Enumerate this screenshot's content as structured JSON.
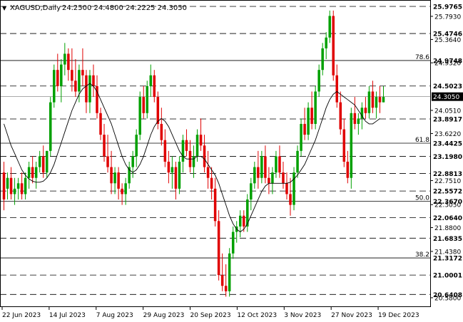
{
  "header": {
    "symbol": "XAGUSD,Daily",
    "ohlc": "24.2500 24.4800 24.2225 24.3050",
    "dropdown_glyph": "▼"
  },
  "colors": {
    "bull": "#00a000",
    "bear": "#e00000",
    "ma": "#000000",
    "grid": "#000000",
    "background": "#ffffff",
    "label_bg": "#ffffff"
  },
  "chart_data": {
    "type": "candlestick",
    "ylim": [
      20.5,
      25.99
    ],
    "x_ticks": [
      "22 Jun 2023",
      "14 Jul 2023",
      "7 Aug 2023",
      "29 Aug 2023",
      "20 Sep 2023",
      "12 Oct 2023",
      "3 Nov 2023",
      "27 Nov 2023",
      "19 Dec 2023"
    ],
    "y_ticks": [
      "25.7930",
      "25.3640",
      "24.9320",
      "24.0510",
      "23.6220",
      "22.7510",
      "22.3050",
      "21.8800",
      "21.4380",
      "20.5800"
    ],
    "levels": [
      {
        "value": 25.9765,
        "label": "25.9765",
        "style": "dashed"
      },
      {
        "value": 25.4746,
        "label": "25.4746",
        "style": "dashed"
      },
      {
        "value": 24.9748,
        "label": "24.9748",
        "style": "solid"
      },
      {
        "value": 24.5023,
        "label": "24.5023",
        "style": "dashed"
      },
      {
        "value": 23.8917,
        "label": "23.8917",
        "style": "dashed"
      },
      {
        "value": 23.4425,
        "label": "23.4425",
        "style": "solid"
      },
      {
        "value": 23.198,
        "label": "23.1980",
        "style": "dashed"
      },
      {
        "value": 22.8813,
        "label": "22.8813",
        "style": "dashed"
      },
      {
        "value": 22.5572,
        "label": "22.5572",
        "style": "dashed"
      },
      {
        "value": 22.367,
        "label": "22.3670",
        "style": "solid"
      },
      {
        "value": 22.064,
        "label": "22.0640",
        "style": "dashed"
      },
      {
        "value": 21.6835,
        "label": "21.6835",
        "style": "dashed"
      },
      {
        "value": 21.3172,
        "label": "21.3172",
        "style": "solid"
      },
      {
        "value": 21.0001,
        "label": "21.0001",
        "style": "dashed"
      },
      {
        "value": 20.6408,
        "label": "20.6408",
        "style": "dashed"
      }
    ],
    "fib_labels": [
      {
        "value": 24.9748,
        "label": "78.6"
      },
      {
        "value": 23.4425,
        "label": "61.8"
      },
      {
        "value": 22.367,
        "label": "50.0"
      },
      {
        "value": 21.3172,
        "label": "38.2"
      }
    ],
    "current_price": {
      "value": 24.305,
      "label": "24.3050"
    },
    "series": [
      {
        "name": "OHLC",
        "ohlc": [
          [
            22.9,
            23.1,
            22.2,
            22.4
          ],
          [
            22.6,
            22.9,
            22.4,
            22.8
          ],
          [
            22.8,
            23.0,
            22.4,
            22.5
          ],
          [
            22.5,
            22.8,
            22.3,
            22.6
          ],
          [
            22.6,
            22.8,
            22.4,
            22.7
          ],
          [
            22.7,
            22.9,
            22.4,
            22.5
          ],
          [
            22.5,
            22.9,
            22.4,
            22.8
          ],
          [
            22.8,
            23.1,
            22.6,
            23.0
          ],
          [
            23.0,
            23.2,
            22.7,
            22.8
          ],
          [
            22.8,
            23.1,
            22.6,
            23.0
          ],
          [
            23.0,
            23.3,
            22.9,
            23.2
          ],
          [
            23.2,
            23.4,
            22.8,
            22.9
          ],
          [
            22.9,
            23.3,
            22.8,
            23.3
          ],
          [
            23.3,
            24.3,
            23.2,
            24.2
          ],
          [
            24.2,
            24.9,
            24.1,
            24.8
          ],
          [
            24.8,
            25.1,
            24.4,
            24.5
          ],
          [
            24.5,
            25.0,
            24.2,
            24.9
          ],
          [
            24.9,
            25.3,
            24.7,
            25.1
          ],
          [
            25.1,
            25.2,
            24.6,
            24.8
          ],
          [
            24.8,
            25.2,
            24.4,
            24.6
          ],
          [
            24.6,
            25.0,
            24.3,
            24.4
          ],
          [
            24.4,
            24.9,
            24.2,
            24.8
          ],
          [
            24.8,
            25.2,
            24.5,
            24.7
          ],
          [
            24.7,
            24.8,
            24.0,
            24.2
          ],
          [
            24.2,
            24.8,
            24.0,
            24.7
          ],
          [
            24.7,
            24.9,
            24.3,
            24.5
          ],
          [
            24.5,
            24.7,
            23.9,
            24.0
          ],
          [
            24.0,
            24.1,
            23.5,
            23.6
          ],
          [
            23.6,
            23.8,
            23.1,
            23.2
          ],
          [
            23.2,
            23.6,
            22.9,
            23.0
          ],
          [
            23.0,
            23.3,
            22.5,
            22.7
          ],
          [
            22.7,
            23.0,
            22.5,
            22.9
          ],
          [
            22.9,
            23.0,
            22.4,
            22.6
          ],
          [
            22.6,
            22.7,
            22.3,
            22.5
          ],
          [
            22.5,
            22.8,
            22.3,
            22.7
          ],
          [
            22.7,
            23.1,
            22.6,
            23.0
          ],
          [
            23.0,
            23.3,
            22.8,
            23.2
          ],
          [
            23.2,
            23.7,
            23.0,
            23.6
          ],
          [
            23.6,
            24.4,
            23.5,
            24.3
          ],
          [
            24.3,
            24.5,
            23.9,
            24.0
          ],
          [
            24.0,
            24.6,
            23.9,
            24.5
          ],
          [
            24.5,
            24.9,
            24.3,
            24.7
          ],
          [
            24.7,
            24.8,
            24.2,
            24.3
          ],
          [
            24.3,
            24.4,
            23.7,
            23.8
          ],
          [
            23.8,
            24.1,
            23.4,
            23.5
          ],
          [
            23.5,
            23.7,
            23.0,
            23.1
          ],
          [
            23.1,
            23.3,
            22.7,
            22.9
          ],
          [
            22.9,
            23.2,
            22.6,
            23.0
          ],
          [
            23.0,
            23.1,
            22.4,
            22.6
          ],
          [
            22.6,
            23.2,
            22.5,
            23.1
          ],
          [
            23.1,
            23.6,
            22.9,
            23.5
          ],
          [
            23.5,
            23.7,
            23.2,
            23.3
          ],
          [
            23.3,
            23.5,
            22.9,
            23.0
          ],
          [
            23.0,
            23.4,
            22.8,
            23.2
          ],
          [
            23.2,
            23.7,
            23.1,
            23.6
          ],
          [
            23.6,
            23.9,
            23.3,
            23.4
          ],
          [
            23.4,
            23.6,
            22.9,
            23.0
          ],
          [
            23.0,
            23.3,
            22.6,
            22.8
          ],
          [
            22.8,
            23.0,
            22.4,
            22.6
          ],
          [
            22.6,
            22.8,
            21.9,
            22.0
          ],
          [
            22.0,
            22.2,
            20.9,
            21.0
          ],
          [
            21.0,
            21.4,
            20.7,
            20.8
          ],
          [
            20.8,
            21.2,
            20.6,
            20.7
          ],
          [
            20.7,
            21.5,
            20.6,
            21.4
          ],
          [
            21.4,
            21.9,
            21.3,
            21.8
          ],
          [
            21.8,
            22.0,
            21.6,
            21.9
          ],
          [
            21.9,
            22.2,
            21.7,
            22.1
          ],
          [
            22.1,
            22.2,
            21.8,
            21.9
          ],
          [
            21.9,
            22.5,
            21.8,
            22.4
          ],
          [
            22.4,
            22.8,
            22.2,
            22.7
          ],
          [
            22.7,
            23.1,
            22.6,
            23.0
          ],
          [
            23.0,
            23.3,
            22.6,
            22.8
          ],
          [
            22.8,
            23.3,
            22.7,
            23.2
          ],
          [
            23.2,
            23.4,
            22.7,
            22.8
          ],
          [
            22.8,
            23.0,
            22.5,
            22.7
          ],
          [
            22.7,
            23.0,
            22.5,
            22.9
          ],
          [
            22.9,
            23.3,
            22.8,
            23.2
          ],
          [
            23.2,
            23.4,
            22.8,
            22.9
          ],
          [
            22.9,
            23.1,
            22.6,
            22.7
          ],
          [
            22.7,
            22.9,
            22.4,
            22.5
          ],
          [
            22.5,
            22.8,
            22.1,
            22.3
          ],
          [
            22.3,
            23.0,
            22.2,
            22.9
          ],
          [
            22.9,
            23.4,
            22.8,
            23.3
          ],
          [
            23.3,
            23.9,
            23.2,
            23.8
          ],
          [
            23.8,
            24.1,
            23.5,
            23.6
          ],
          [
            23.6,
            24.2,
            23.5,
            24.1
          ],
          [
            24.1,
            24.4,
            23.7,
            23.8
          ],
          [
            23.8,
            24.5,
            23.7,
            24.4
          ],
          [
            24.4,
            24.9,
            24.3,
            24.8
          ],
          [
            24.8,
            25.3,
            24.7,
            25.2
          ],
          [
            25.2,
            25.5,
            25.0,
            25.4
          ],
          [
            25.4,
            25.9,
            25.3,
            25.8
          ],
          [
            25.8,
            25.9,
            24.6,
            24.7
          ],
          [
            24.7,
            24.9,
            24.1,
            24.2
          ],
          [
            24.2,
            24.4,
            23.6,
            23.7
          ],
          [
            23.7,
            23.9,
            23.0,
            23.1
          ],
          [
            23.1,
            23.3,
            22.7,
            22.8
          ],
          [
            22.8,
            24.1,
            22.6,
            24.0
          ],
          [
            24.0,
            24.3,
            23.7,
            23.8
          ],
          [
            23.8,
            24.0,
            23.6,
            23.9
          ],
          [
            23.9,
            24.2,
            23.7,
            24.1
          ],
          [
            24.1,
            24.3,
            23.9,
            24.0
          ],
          [
            24.0,
            24.5,
            23.9,
            24.4
          ],
          [
            24.4,
            24.6,
            24.0,
            24.1
          ],
          [
            24.1,
            24.4,
            23.9,
            24.3
          ],
          [
            24.3,
            24.5,
            24.0,
            24.2
          ],
          [
            24.2,
            24.5,
            24.2,
            24.3
          ]
        ]
      },
      {
        "name": "MA",
        "values": [
          23.8,
          23.6,
          23.4,
          23.25,
          23.1,
          22.95,
          22.85,
          22.78,
          22.74,
          22.72,
          22.72,
          22.74,
          22.8,
          22.9,
          23.05,
          23.25,
          23.45,
          23.65,
          23.85,
          24.05,
          24.2,
          24.35,
          24.45,
          24.5,
          24.55,
          24.5,
          24.4,
          24.25,
          24.1,
          23.95,
          23.8,
          23.6,
          23.4,
          23.2,
          23.05,
          22.95,
          22.9,
          22.95,
          23.05,
          23.2,
          23.4,
          23.6,
          23.75,
          23.85,
          23.9,
          23.85,
          23.75,
          23.6,
          23.45,
          23.3,
          23.2,
          23.15,
          23.15,
          23.15,
          23.2,
          23.2,
          23.15,
          23.05,
          22.95,
          22.85,
          22.7,
          22.5,
          22.3,
          22.1,
          21.95,
          21.85,
          21.8,
          21.85,
          21.95,
          22.1,
          22.25,
          22.4,
          22.55,
          22.65,
          22.7,
          22.7,
          22.7,
          22.7,
          22.7,
          22.7,
          22.72,
          22.78,
          22.85,
          22.95,
          23.05,
          23.2,
          23.35,
          23.5,
          23.7,
          23.9,
          24.1,
          24.25,
          24.35,
          24.4,
          24.35,
          24.3,
          24.25,
          24.2,
          24.15,
          24.05,
          23.95,
          23.85,
          23.8,
          23.8,
          23.85,
          23.9
        ]
      }
    ]
  }
}
